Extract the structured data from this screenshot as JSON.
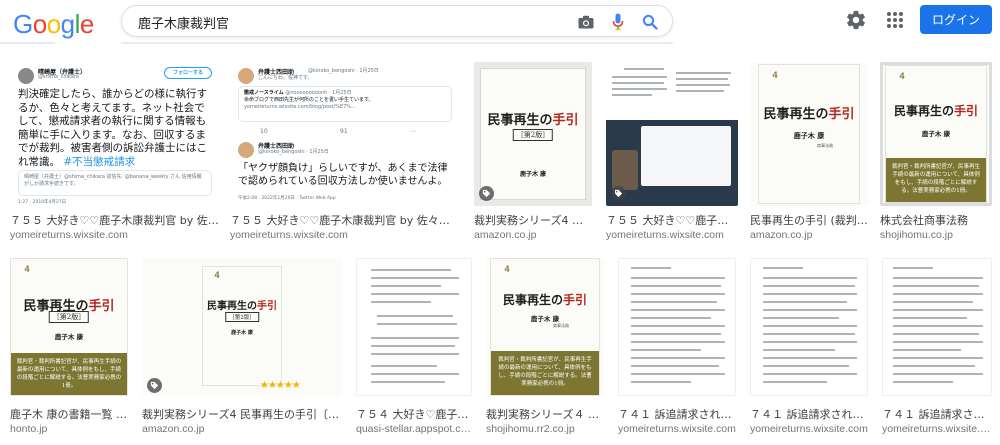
{
  "logo": {
    "text": "Google",
    "letters": [
      "G",
      "o",
      "o",
      "g",
      "l",
      "e"
    ],
    "colors": [
      "#4285F4",
      "#EA4335",
      "#FBBC05",
      "#4285F4",
      "#34A853",
      "#EA4335"
    ]
  },
  "search": {
    "query": "鹿子木康裁判官",
    "placeholder": ""
  },
  "header": {
    "login_label": "ログイン"
  },
  "colors": {
    "accent": "#1a73e8",
    "band": "#7c7632",
    "cover_red": "#b3261e"
  },
  "tweets": {
    "t1": {
      "name": "晴崎屋（弁護士）",
      "handle": "@shima_chikara",
      "follow": "フォローする",
      "body": "判決確定したら、誰からどの様に執行するか、色々と考えてます。ネット社会でして、懲戒請求者の執行に関する情報も簡単に手に入ります。なお、回収するまでが裁判。被害者側の訴訟弁護士にはこれ常識。",
      "hashtag": "#不当懲戒請求",
      "quote": "晴崎屋（弁護士）@shima_chikara 返信先: @banana_weekly さん 信用情報がしか請求手続きです。",
      "footer": "1:27 - 2019年4月27日"
    },
    "t2": {
      "name": "弁護士西田助",
      "handle": "@kinoko_bengoshi · 1月25日",
      "greet": "こんにちわ。佐神です。",
      "q_name": "懲戒ノースライム",
      "q_handle": "@nooooooooonh · 1月25日",
      "q_body": "余命ブログで西田先生が何所のことを書い手生ています。",
      "q_url": "yomeireturns.wixsite.com/blog/post/%E7%...",
      "counts": [
        "10",
        "91",
        "⋯"
      ],
      "body": "「ヤクザ顔負け」らしいですが、あくまで法律で認められている回収方法しか使いませんよ。",
      "footer": "午後2:08 · 2022年1月26日 · Twitter Web App"
    }
  },
  "book": {
    "title_black": "民事再生の",
    "title_red": "手引",
    "edition": "［第2版］",
    "author": "鹿子木 康",
    "author_suffix": "編",
    "emblem": "4",
    "publisher": "商事法務",
    "band_text": "裁判官・裁判所書記官が、民事再生手続の最新の運用について、具体例をもし、手続の段階ごとに解説する。法曹実務家必携の1冊。"
  },
  "rating": {
    "stars": "★★★★★"
  },
  "results": [
    {
      "title": "７５５ 大好き♡♡鹿子木康裁判官 by 佐々木...",
      "source": "yomeireturns.wixsite.com"
    },
    {
      "title": "７５５ 大好き♡♡鹿子木康裁判官 by 佐々木晃...",
      "source": "yomeireturns.wixsite.com"
    },
    {
      "title": "裁判実務シリーズ4 民事再生の手引...",
      "source": "amazon.co.jp"
    },
    {
      "title": "７５５ 大好き♡♡鹿子木康...",
      "source": "yomeireturns.wixsite.com"
    },
    {
      "title": "民事再生の手引 (裁判実務シリーズ)",
      "source": "amazon.co.jp"
    },
    {
      "title": "株式会社商事法務",
      "source": "shojihomu.co.jp"
    },
    {
      "title": "鹿子木 康の書籍一覧 - honto",
      "source": "honto.jp"
    },
    {
      "title": "裁判実務シリーズ4 民事再生の手引〔第2版〕",
      "source": "amazon.co.jp"
    },
    {
      "title": "７５４ 大好き♡鹿子木康...",
      "source": "quasi-stellar.appspot.com"
    },
    {
      "title": "裁判実務シリーズ４ 民事再生の...",
      "source": "shojihomu.rr2.co.jp"
    },
    {
      "title": "７４１ 訴追請求されち...",
      "source": "yomeireturns.wixsite.com"
    },
    {
      "title": "７４１ 訴追請求されち...",
      "source": "yomeireturns.wixsite.com"
    },
    {
      "title": "７４１ 訴追請求されち...",
      "source": "yomeireturns.wixsite.com"
    }
  ]
}
